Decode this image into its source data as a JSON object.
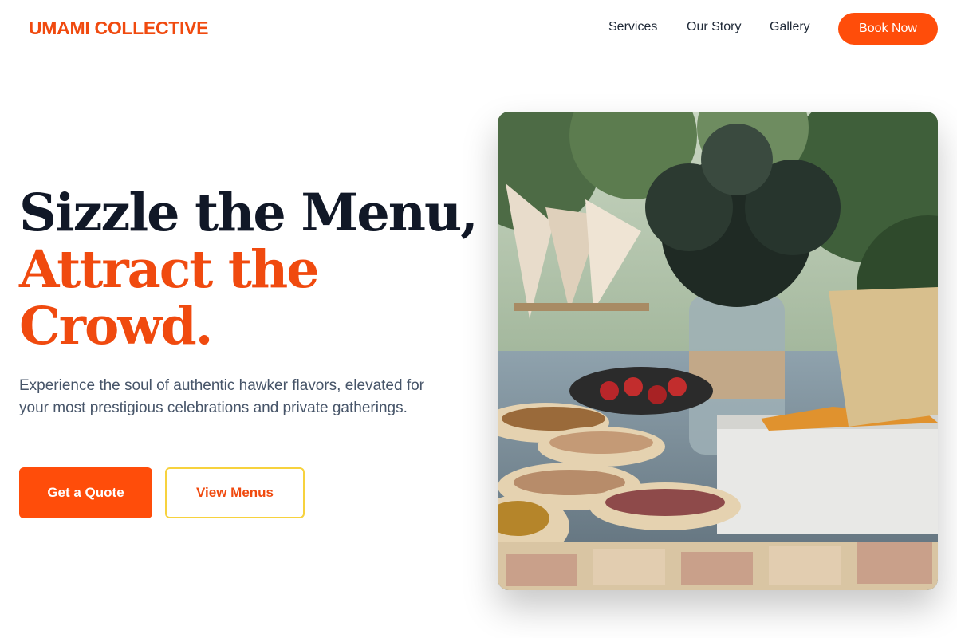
{
  "brand": {
    "name": "UMAMI COLLECTIVE",
    "color": "#f04a0f"
  },
  "nav": {
    "items": [
      {
        "label": "Services"
      },
      {
        "label": "Our Story"
      },
      {
        "label": "Gallery"
      }
    ],
    "cta_label": "Book Now"
  },
  "hero": {
    "title_line1": "Sizzle the Menu,",
    "title_accent": "Attract the Crowd.",
    "description": "Experience the soul of authentic hawker flavors, elevated for your most prestigious celebrations and private gatherings.",
    "primary_button": "Get a Quote",
    "secondary_button": "View Menus"
  },
  "colors": {
    "accent": "#ff4d0a",
    "heading": "#111827",
    "body_text": "#475569",
    "outline_button_border": "#f7d23e"
  }
}
